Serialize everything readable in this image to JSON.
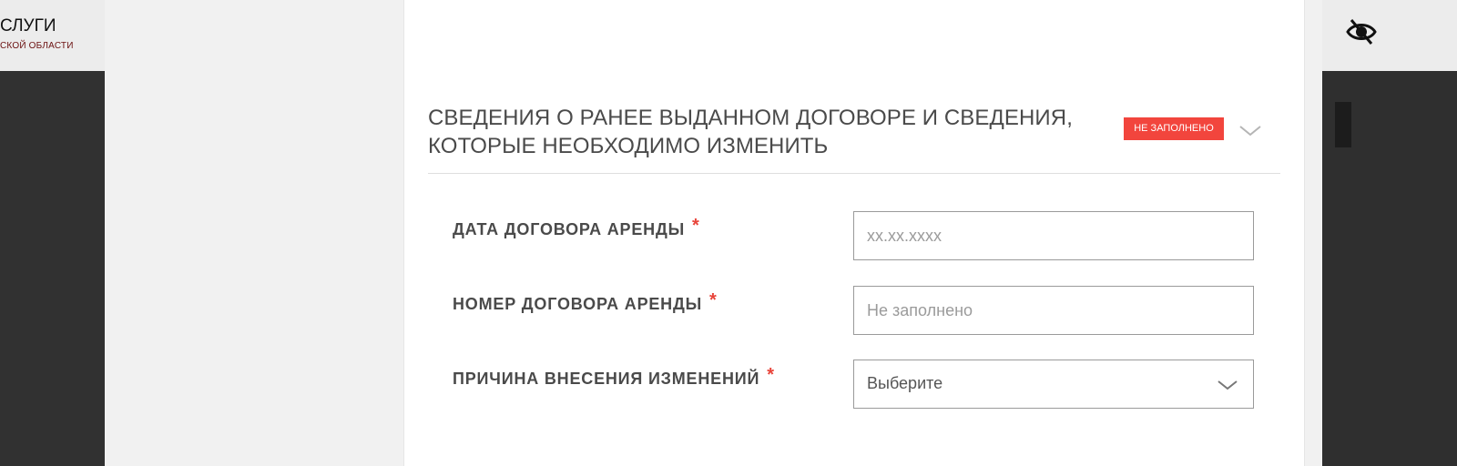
{
  "background": {
    "logo_title": "СЛУГИ",
    "logo_subtitle": "СКОЙ ОБЛАСТИ",
    "accessibility_icon": "eye-icon"
  },
  "section": {
    "title_line1": "СВЕДЕНИЯ О РАНЕЕ ВЫДАННОМ ДОГОВОРЕ И СВЕДЕНИЯ,",
    "title_line2": "КОТОРЫЕ НЕОБХОДИМО ИЗМЕНИТЬ",
    "status_badge": "НЕ ЗАПОЛНЕНО",
    "status_color": "#f2453d",
    "collapse_icon": "chevron-down-icon"
  },
  "fields": {
    "contract_date": {
      "label": "ДАТА ДОГОВОРА АРЕНДЫ",
      "required_mark": "*",
      "placeholder": "xx.xx.xxxx",
      "value": ""
    },
    "contract_number": {
      "label": "НОМЕР ДОГОВОРА АРЕНДЫ",
      "required_mark": "*",
      "placeholder": "Не заполнено",
      "value": ""
    },
    "change_reason": {
      "label": "ПРИЧИНА ВНЕСЕНИЯ ИЗМЕНЕНИЙ",
      "required_mark": "*",
      "selected": "Выберите",
      "icon": "chevron-down-icon"
    }
  }
}
